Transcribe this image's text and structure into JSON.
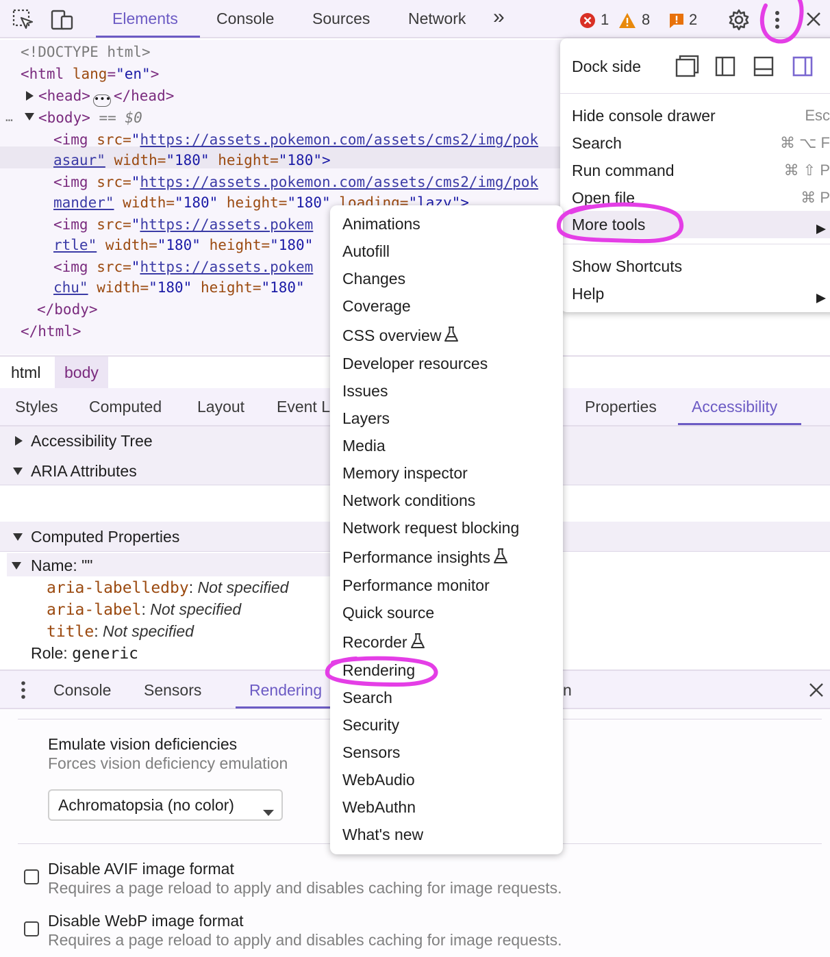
{
  "toolbar": {
    "tabs": [
      "Elements",
      "Console",
      "Sources",
      "Network"
    ],
    "active_tab": "Elements",
    "overflow": "»",
    "errors": "1",
    "warnings": "8",
    "issues": "2"
  },
  "dom": {
    "doctype": "<!DOCTYPE html>",
    "html_open": "<html",
    "html_lang_attr": "lang",
    "html_lang_val": "\"en\"",
    "head_open": "<head>",
    "head_close": "</head>",
    "body_open": "<body>",
    "body_marker": "== $0",
    "img_prefix": "<img ",
    "src_attr": "src=",
    "url_1": "https://assets.pokemon.com/assets/cms2/img/pok",
    "cont_1": "asaur\"",
    "url_2": "https://assets.pokemon.com/assets/cms2/img/pok",
    "cont_2": "mander\"",
    "url_3": "https://assets.pokem",
    "cont_3": "rtle\"",
    "url_4": "https://assets.pokem",
    "cont_4": "chu\"",
    "width_attr": "width=",
    "width_val": "\"180\"",
    "height_attr": "height=",
    "height_val_close": "\"180\">",
    "height_val": "\"180\"",
    "loading_attr": "loading=",
    "loading_val": "\"lazy\">",
    "body_close": "</body>",
    "html_close": "</html>"
  },
  "breadcrumb": [
    "html",
    "body"
  ],
  "subtabs": [
    "Styles",
    "Computed",
    "Layout",
    "Event L",
    "Properties",
    "Accessibility"
  ],
  "accessibility": {
    "tree": "Accessibility Tree",
    "aria": "ARIA Attributes",
    "computed": "Computed Properties",
    "name_label": "Name: \"\"",
    "props": [
      {
        "name": "aria-labelledby",
        "value": "Not specified"
      },
      {
        "name": "aria-label",
        "value": "Not specified"
      },
      {
        "name": "title",
        "value": "Not specified"
      }
    ],
    "role_label": "Role: ",
    "role_value": "generic"
  },
  "drawer": {
    "tabs": [
      "Console",
      "Sensors",
      "Rendering"
    ],
    "hidden_tab_tail": "n",
    "vision_title": "Emulate vision deficiencies",
    "vision_desc": "Forces vision deficiency emulation",
    "vision_select": "Achromatopsia (no color)",
    "avif_title": "Disable AVIF image format",
    "avif_desc": "Requires a page reload to apply and disables caching for image requests.",
    "webp_title": "Disable WebP image format",
    "webp_desc": "Requires a page reload to apply and disables caching for image requests."
  },
  "main_menu": {
    "dock_side": "Dock side",
    "items": [
      {
        "label": "Hide console drawer",
        "shortcut": "Esc"
      },
      {
        "label": "Search",
        "shortcut": "⌘ ⌥ F"
      },
      {
        "label": "Run command",
        "shortcut": "⌘ ⇧ P"
      },
      {
        "label": "Open file",
        "shortcut": "⌘ P"
      },
      {
        "label": "More tools",
        "shortcut": ""
      },
      {
        "label": "Show Shortcuts",
        "shortcut": ""
      },
      {
        "label": "Help",
        "shortcut": ""
      }
    ]
  },
  "more_tools": [
    "Animations",
    "Autofill",
    "Changes",
    "Coverage",
    "CSS overview",
    "Developer resources",
    "Issues",
    "Layers",
    "Media",
    "Memory inspector",
    "Network conditions",
    "Network request blocking",
    "Performance insights",
    "Performance monitor",
    "Quick source",
    "Recorder",
    "Rendering",
    "Search",
    "Security",
    "Sensors",
    "WebAudio",
    "WebAuthn",
    "What's new"
  ],
  "colors": {
    "accent": "#6c5bc4",
    "highlight": "#e43ee6"
  }
}
